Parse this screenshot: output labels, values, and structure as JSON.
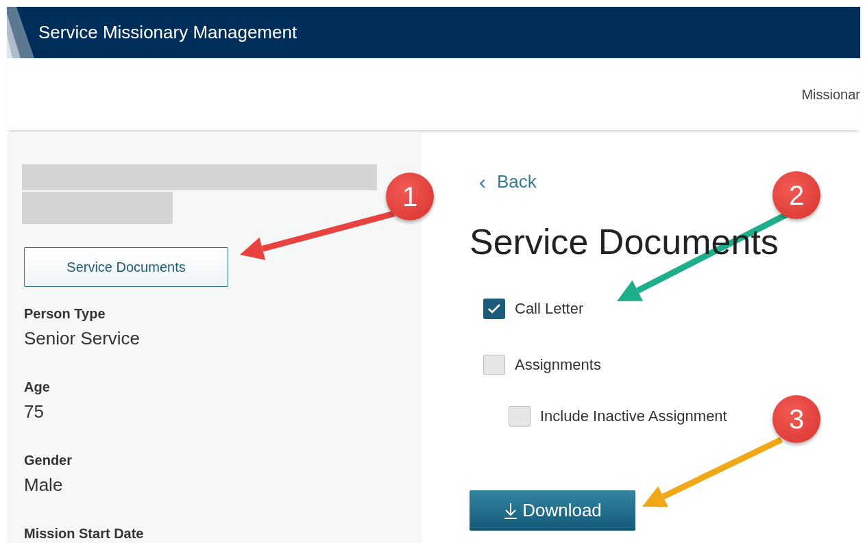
{
  "header": {
    "title": "Service Missionary Management"
  },
  "subheader": {
    "nav_text": "Missionar"
  },
  "sidebar": {
    "button": "Service Documents",
    "fields": [
      {
        "label": "Person Type",
        "value": "Senior Service"
      },
      {
        "label": "Age",
        "value": "75"
      },
      {
        "label": "Gender",
        "value": "Male"
      },
      {
        "label": "Mission Start Date"
      }
    ]
  },
  "main": {
    "back": "Back",
    "back_icon": "‹",
    "heading": "Service Documents",
    "options": [
      {
        "label": "Call Letter",
        "checked": true
      },
      {
        "label": "Assignments",
        "checked": false,
        "children": [
          {
            "label": "Include Inactive Assignment",
            "checked": false
          }
        ]
      }
    ],
    "download": {
      "label": "Download"
    }
  },
  "annotations": [
    {
      "number": "1",
      "color": "#e8433e"
    },
    {
      "number": "2",
      "color": "#1fae8c"
    },
    {
      "number": "3",
      "color": "#f0a818"
    }
  ]
}
